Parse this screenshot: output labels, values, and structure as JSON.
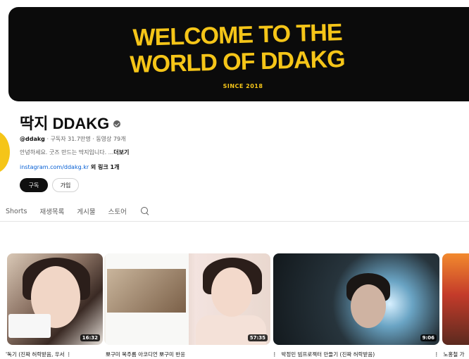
{
  "banner": {
    "line1": "WELCOME TO THE",
    "line2": "WORLD OF DDAKG",
    "since": "SINCE 2018"
  },
  "channel": {
    "name": "딱지 DDAKG",
    "handle": "@ddakg",
    "stats": " · 구독자 31.7만명 · 동영상 79개",
    "description": "안녕하세요. 굿즈 만드는 딱지입니다. ...",
    "more_label": "더보기",
    "link_url": "instagram.com/ddakg.kr",
    "link_more": " 외 링크 1개"
  },
  "buttons": {
    "subscribe": "구독",
    "join": "가입"
  },
  "tabs": [
    "Shorts",
    "재생목록",
    "게시물",
    "스토어"
  ],
  "videos": [
    {
      "duration": "16:32",
      "title": "'독기 (진짜 허락받음, 우서"
    },
    {
      "duration": "57:35",
      "title": "뽀구미 목주름 아코디언 뽀구미 반응"
    },
    {
      "duration": "9:06",
      "title": "박정민 빔프로젝터 만들기 (진짜 허락받음)"
    },
    {
      "duration": "",
      "title": "노홍철 가"
    }
  ],
  "icons": {
    "verified": "verified-check-icon",
    "search": "search-icon",
    "more": "more-vertical-icon"
  },
  "colors": {
    "banner_bg": "#0b0b0b",
    "banner_text": "#f5c518",
    "link": "#065fd4",
    "subscribe_bg": "#0f0f0f"
  }
}
